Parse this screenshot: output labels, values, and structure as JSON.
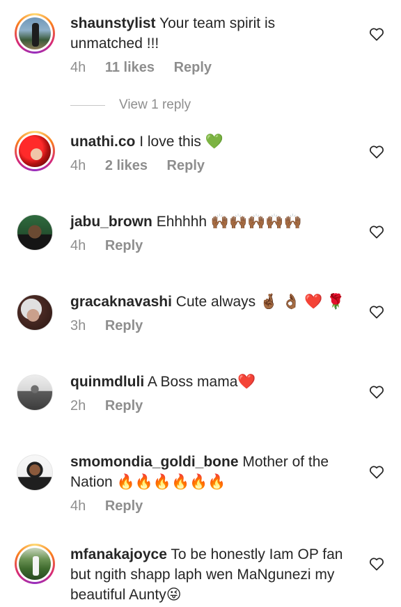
{
  "comments": [
    {
      "username": "shaunstylist",
      "text": "Your team spirit is unmatched !!!",
      "time": "4h",
      "likes": "11 likes",
      "reply": "Reply",
      "avatar": "story-ring",
      "avatar_colors": [
        "#5b86a8",
        "#2d4a2f",
        "#c9b48a"
      ]
    },
    {
      "username": "unathi.co",
      "text": "I love this 💚",
      "time": "4h",
      "likes": "2 likes",
      "reply": "Reply",
      "avatar": "story-ring",
      "avatar_colors": [
        "#e51c1c",
        "#7a0f0f",
        "#f2c9b0"
      ]
    },
    {
      "username": "jabu_brown",
      "text": "Ehhhhh 🙌🏾🙌🏾🙌🏾🙌🏾🙌🏾",
      "time": "4h",
      "reply": "Reply",
      "avatar": "plain",
      "avatar_colors": [
        "#2c5e3a",
        "#1c1c1c",
        "#6a4a32"
      ]
    },
    {
      "username": "gracaknavashi",
      "text": "Cute always 🤞🏾 👌🏾 ❤️ 🌹",
      "time": "3h",
      "reply": "Reply",
      "avatar": "plain",
      "avatar_colors": [
        "#d9d9d9",
        "#4a2a24",
        "#caa08c"
      ]
    },
    {
      "username": "quinmdluli",
      "text": "A Boss mama❤️",
      "time": "2h",
      "reply": "Reply",
      "avatar": "plain",
      "avatar_colors": [
        "#e8e8e8",
        "#555555",
        "#9a9a9a"
      ]
    },
    {
      "username": "smomondia_goldi_bone",
      "text": "Mother of the Nation 🔥🔥🔥🔥🔥🔥",
      "time": "4h",
      "reply": "Reply",
      "avatar": "plain",
      "avatar_colors": [
        "#f4f4f4",
        "#1f1f1f",
        "#8b5a3c"
      ]
    },
    {
      "username": "mfanakajoyce",
      "text": "To be honestly Iam OP fan but ngith shapp laph wen MaNgunezi my beautiful Aunty😜",
      "time": "",
      "reply": "",
      "avatar": "story-ring",
      "avatar_colors": [
        "#4f7a3a",
        "#2a4a22",
        "#c7d3b8"
      ]
    }
  ],
  "view_replies": "View 1 reply",
  "colors": {
    "text": "#262626",
    "meta": "#8e8e8e",
    "divider": "#c7c7c7",
    "heart": "#262626"
  },
  "icons": {
    "like": "heart-outline-icon"
  }
}
